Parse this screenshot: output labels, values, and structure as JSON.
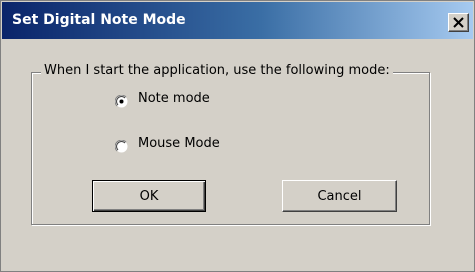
{
  "dialog": {
    "title": "Set Digital Note Mode",
    "close_glyph": "×"
  },
  "group": {
    "label": "When I start the application, use the following mode:"
  },
  "options": [
    {
      "label": "Note mode",
      "selected": true
    },
    {
      "label": "Mouse Mode",
      "selected": false
    }
  ],
  "buttons": {
    "ok_label": "OK",
    "cancel_label": "Cancel"
  },
  "colors": {
    "title_gradient_start": "#0a246a",
    "title_gradient_end": "#a6caf0",
    "dialog_face": "#d4d0c8"
  },
  "icons": {
    "close": "close-icon",
    "radio": "radio-icon"
  }
}
